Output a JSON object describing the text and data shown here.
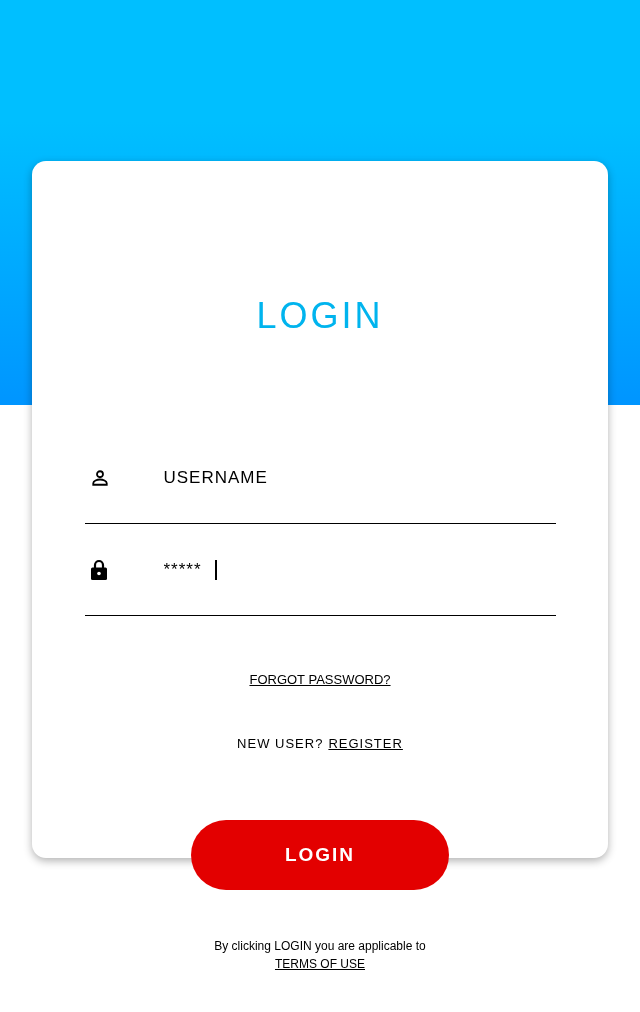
{
  "title": "LOGIN",
  "fields": [
    {
      "kind": "user",
      "placeholder": "USERNAME",
      "focused": false
    },
    {
      "kind": "lock",
      "value": "*****",
      "focused": true
    }
  ],
  "forgot_link": "FORGOT PASSWORD?",
  "register": {
    "prompt": "NEW USER?",
    "link": "REGISTER"
  },
  "login_button": "LOGIN",
  "terms": {
    "text": "By clicking LOGIN you are applicable to",
    "link": "TERMS OF USE"
  }
}
